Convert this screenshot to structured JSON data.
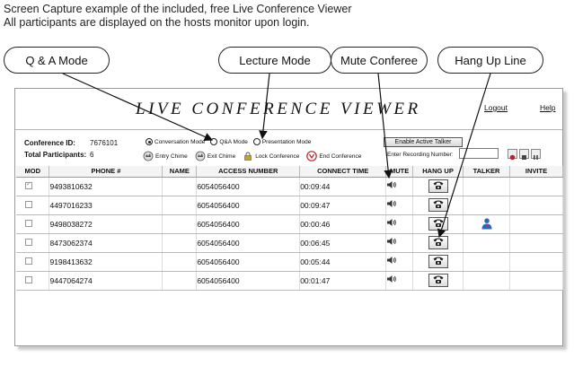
{
  "caption": {
    "line1": "Screen Capture example of the included, free Live Conference Viewer",
    "line2": "All participants are displayed on the hosts monitor upon login."
  },
  "callouts": {
    "qa_mode": "Q & A Mode",
    "lecture_mode": "Lecture Mode",
    "mute_conferee": "Mute Conferee",
    "hang_up_line": "Hang Up Line"
  },
  "app": {
    "title": "LIVE CONFERENCE VIEWER",
    "logout": "Logout",
    "help": "Help"
  },
  "info": {
    "conference_id_label": "Conference ID:",
    "conference_id": "7676101",
    "participants_label": "Total Participants:",
    "participants": "6"
  },
  "modes": {
    "conversation": "Conversation Mode",
    "qa": "Q&A Mode",
    "presentation": "Presentation Mode"
  },
  "options": {
    "entry_chime": "Entry Chime",
    "exit_chime": "Exit Chime",
    "lock_conference": "Lock Conference",
    "end_conference": "End Conference"
  },
  "controls": {
    "enable_active_talker": "Enable Active Talker",
    "recording_label": "Enter Recording Number:"
  },
  "table": {
    "headers": [
      "MOD",
      "PHONE #",
      "NAME",
      "ACCESS NUMBER",
      "CONNECT TIME",
      "MUTE",
      "HANG UP",
      "TALKER",
      "INVITE"
    ],
    "rows": [
      {
        "phone": "9493810632",
        "name": "",
        "access": "6054056400",
        "time": "00:09:44",
        "mod": true,
        "talker": false
      },
      {
        "phone": "4497016233",
        "name": "",
        "access": "6054056400",
        "time": "00:09:47",
        "mod": false,
        "talker": false
      },
      {
        "phone": "9498038272",
        "name": "",
        "access": "6054056400",
        "time": "00:00:46",
        "mod": false,
        "talker": true
      },
      {
        "phone": "8473062374",
        "name": "",
        "access": "6054056400",
        "time": "00:06:45",
        "mod": false,
        "talker": false
      },
      {
        "phone": "9198413632",
        "name": "",
        "access": "6054056400",
        "time": "00:05:44",
        "mod": false,
        "talker": false
      },
      {
        "phone": "9447064274",
        "name": "",
        "access": "6054056400",
        "time": "00:01:47",
        "mod": false,
        "talker": false
      }
    ]
  },
  "icons": {
    "mute": "speaker-icon",
    "hang_up": "phone-icon",
    "talker": "person-icon"
  },
  "colors": {
    "accent_red": "#b5262a",
    "talker_blue": "#2a67b8"
  }
}
